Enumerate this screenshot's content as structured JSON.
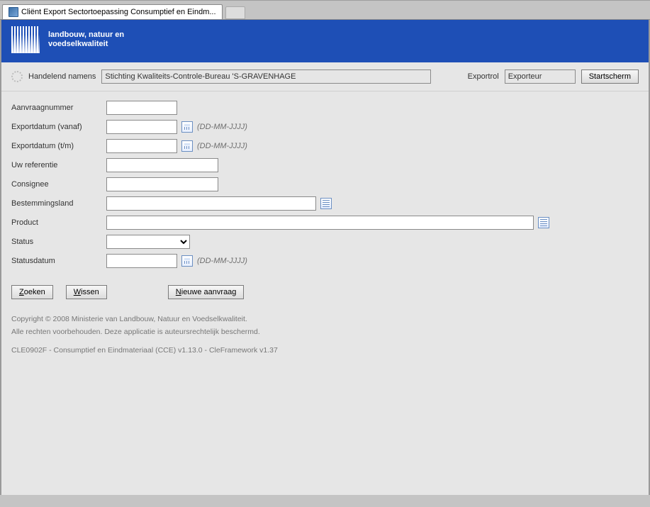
{
  "window": {
    "tab_title": "Cliënt Export Sectortoepassing Consumptief en Eindm..."
  },
  "banner": {
    "ministry": "landbouw, natuur en\nvoedselkwaliteit"
  },
  "topbar": {
    "handelend_label": "Handelend namens",
    "handelend_value": "Stichting Kwaliteits-Controle-Bureau 'S-GRAVENHAGE",
    "exportrol_label": "Exportrol",
    "exportrol_value": "Exporteur",
    "start_button": "Startscherm"
  },
  "form": {
    "aanvraagnummer_label": "Aanvraagnummer",
    "aanvraagnummer_value": "",
    "exportdatum_vanaf_label": "Exportdatum (vanaf)",
    "exportdatum_vanaf_value": "",
    "exportdatum_tm_label": "Exportdatum (t/m)",
    "exportdatum_tm_value": "",
    "date_hint": "(DD-MM-JJJJ)",
    "uw_referentie_label": "Uw referentie",
    "uw_referentie_value": "",
    "consignee_label": "Consignee",
    "consignee_value": "",
    "bestemmingsland_label": "Bestemmingsland",
    "bestemmingsland_value": "",
    "product_label": "Product",
    "product_value": "",
    "status_label": "Status",
    "status_value": "",
    "statusdatum_label": "Statusdatum",
    "statusdatum_value": ""
  },
  "buttons": {
    "zoeken": "Zoeken",
    "wissen": "Wissen",
    "nieuwe": "Nieuwe aanvraag",
    "zoeken_accel": "Z",
    "wissen_accel": "W",
    "nieuwe_accel": "N"
  },
  "footer": {
    "copyright": "Copyright © 2008 Ministerie van Landbouw, Natuur en Voedselkwaliteit.",
    "rights": "Alle rechten voorbehouden. Deze applicatie is auteursrechtelijk beschermd.",
    "version": "CLE0902F - Consumptief en Eindmateriaal (CCE) v1.13.0 - CleFramework v1.37"
  }
}
